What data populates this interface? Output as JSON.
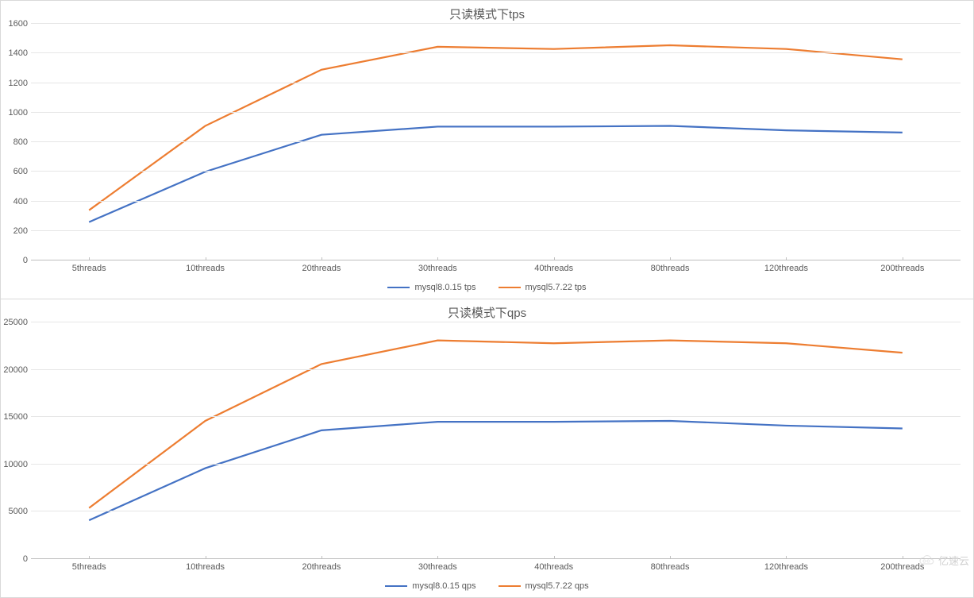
{
  "colors": {
    "series_a": "#4472C4",
    "series_b": "#ED7D31"
  },
  "watermark": "亿速云",
  "chart_data": [
    {
      "type": "line",
      "title": "只读模式下tps",
      "xlabel": "",
      "ylabel": "",
      "ylim": [
        0,
        1600
      ],
      "ystep": 200,
      "categories": [
        "5threads",
        "10threads",
        "20threads",
        "30threads",
        "40threads",
        "80threads",
        "120threads",
        "200threads"
      ],
      "series": [
        {
          "name": "mysql8.0.15 tps",
          "color_key": "series_a",
          "values": [
            260,
            600,
            850,
            905,
            905,
            910,
            880,
            865
          ]
        },
        {
          "name": "mysql5.7.22 tps",
          "color_key": "series_b",
          "values": [
            340,
            910,
            1290,
            1445,
            1430,
            1455,
            1430,
            1360
          ]
        }
      ],
      "legend_position": "bottom"
    },
    {
      "type": "line",
      "title": "只读模式下qps",
      "xlabel": "",
      "ylabel": "",
      "ylim": [
        0,
        25000
      ],
      "ystep": 5000,
      "categories": [
        "5threads",
        "10threads",
        "20threads",
        "30threads",
        "40threads",
        "80threads",
        "120threads",
        "200threads"
      ],
      "series": [
        {
          "name": "mysql8.0.15 qps",
          "color_key": "series_a",
          "values": [
            4100,
            9600,
            13600,
            14500,
            14500,
            14600,
            14100,
            13800
          ]
        },
        {
          "name": "mysql5.7.22 qps",
          "color_key": "series_b",
          "values": [
            5400,
            14600,
            20600,
            23100,
            22800,
            23100,
            22800,
            21800
          ]
        }
      ],
      "legend_position": "bottom"
    }
  ]
}
